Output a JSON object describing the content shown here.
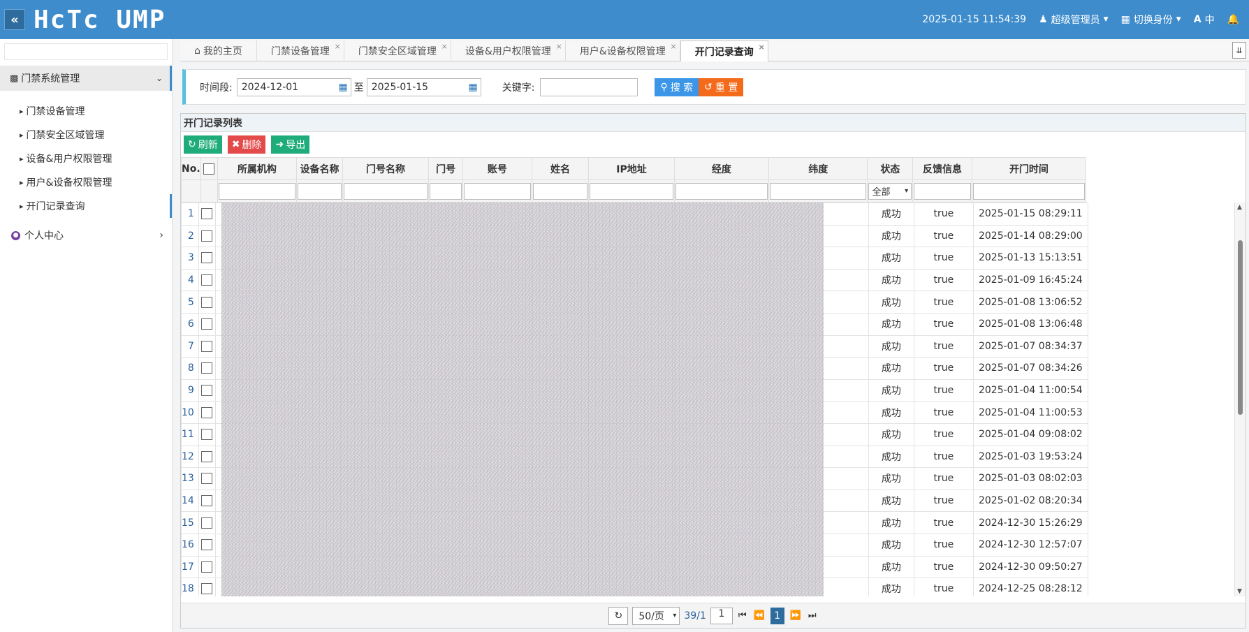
{
  "header": {
    "logo": "HcTc UMP",
    "datetime": "2025-01-15 11:54:39",
    "user": "超级管理员",
    "switch_identity": "切换身份",
    "lang": "中"
  },
  "sidebar": {
    "group_access": "门禁系统管理",
    "items": [
      "门禁设备管理",
      "门禁安全区域管理",
      "设备&用户权限管理",
      "用户&设备权限管理",
      "开门记录查询"
    ],
    "group_personal": "个人中心"
  },
  "tabs": [
    "我的主页",
    "门禁设备管理",
    "门禁安全区域管理",
    "设备&用户权限管理",
    "用户&设备权限管理",
    "开门记录查询"
  ],
  "search": {
    "period_label": "时间段:",
    "date_from": "2024-12-01",
    "to_label": "至",
    "date_to": "2025-01-15",
    "keyword_label": "关键字:",
    "search_btn": "搜 索",
    "reset_btn": "重 置"
  },
  "grid": {
    "title": "开门记录列表",
    "refresh_btn": "刷新",
    "delete_btn": "删除",
    "export_btn": "导出",
    "columns": [
      "No.",
      "所属机构",
      "设备名称",
      "门号名称",
      "门号",
      "账号",
      "姓名",
      "IP地址",
      "经度",
      "纬度",
      "状态",
      "反馈信息",
      "开门时间"
    ],
    "status_filter": "全部",
    "rows": [
      {
        "no": "1",
        "status": "成功",
        "feedback": "true",
        "time": "2025-01-15 08:29:11"
      },
      {
        "no": "2",
        "status": "成功",
        "feedback": "true",
        "time": "2025-01-14 08:29:00"
      },
      {
        "no": "3",
        "status": "成功",
        "feedback": "true",
        "time": "2025-01-13 15:13:51"
      },
      {
        "no": "4",
        "status": "成功",
        "feedback": "true",
        "time": "2025-01-09 16:45:24"
      },
      {
        "no": "5",
        "status": "成功",
        "feedback": "true",
        "time": "2025-01-08 13:06:52"
      },
      {
        "no": "6",
        "status": "成功",
        "feedback": "true",
        "time": "2025-01-08 13:06:48"
      },
      {
        "no": "7",
        "status": "成功",
        "feedback": "true",
        "time": "2025-01-07 08:34:37"
      },
      {
        "no": "8",
        "status": "成功",
        "feedback": "true",
        "time": "2025-01-07 08:34:26"
      },
      {
        "no": "9",
        "status": "成功",
        "feedback": "true",
        "time": "2025-01-04 11:00:54"
      },
      {
        "no": "10",
        "status": "成功",
        "feedback": "true",
        "time": "2025-01-04 11:00:53"
      },
      {
        "no": "11",
        "status": "成功",
        "feedback": "true",
        "time": "2025-01-04 09:08:02"
      },
      {
        "no": "12",
        "status": "成功",
        "feedback": "true",
        "time": "2025-01-03 19:53:24"
      },
      {
        "no": "13",
        "status": "成功",
        "feedback": "true",
        "time": "2025-01-03 08:02:03"
      },
      {
        "no": "14",
        "status": "成功",
        "feedback": "true",
        "time": "2025-01-02 08:20:34"
      },
      {
        "no": "15",
        "status": "成功",
        "feedback": "true",
        "time": "2024-12-30 15:26:29"
      },
      {
        "no": "16",
        "status": "成功",
        "feedback": "true",
        "time": "2024-12-30 12:57:07"
      },
      {
        "no": "17",
        "status": "成功",
        "feedback": "true",
        "time": "2024-12-30 09:50:27"
      },
      {
        "no": "18",
        "status": "成功",
        "feedback": "true",
        "time": "2024-12-25 08:28:12"
      }
    ]
  },
  "pager": {
    "page_size": "50/页",
    "count": "39/1",
    "page_input": "1",
    "current": "1"
  },
  "colors": {
    "header_bg": "#3e8ccc",
    "search_btn": "#3c96e8",
    "reset_btn": "#f36a1b",
    "green_btn": "#1fac7b",
    "red_btn": "#e34b4b"
  }
}
